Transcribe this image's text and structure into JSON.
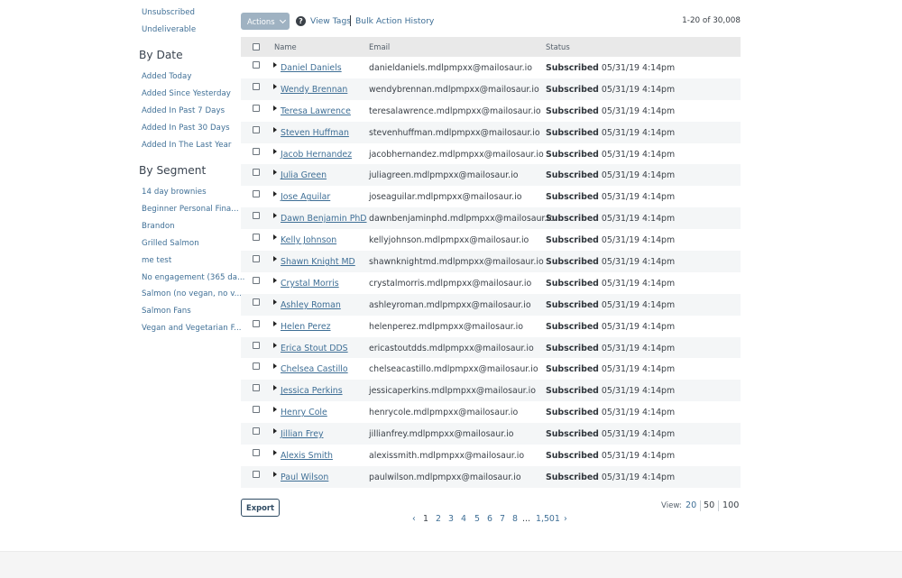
{
  "sidebar": {
    "top_links": [
      "Unsubscribed",
      "Undeliverable"
    ],
    "by_date_heading": "By Date",
    "by_date": [
      "Added Today",
      "Added Since Yesterday",
      "Added In Past 7 Days",
      "Added In Past 30 Days",
      "Added In The Last Year"
    ],
    "by_segment_heading": "By Segment",
    "by_segment": [
      "14 day brownies",
      "Beginner Personal Fina...",
      "Brandon",
      "Grilled Salmon",
      "me test",
      "No engagement (365 da...",
      "Salmon (no vegan, no v...",
      "Salmon Fans",
      "Vegan and Vegetarian F..."
    ]
  },
  "toolbar": {
    "actions_label": "Actions",
    "help_icon": "question-circle-icon",
    "view_tags": "View Tags",
    "bulk_history": "Bulk Action History",
    "range": "1-20 of 30,008"
  },
  "table": {
    "headers": {
      "name": "Name",
      "email": "Email",
      "status": "Status"
    },
    "rows": [
      {
        "name": "Daniel Daniels",
        "email": "danieldaniels.mdlpmpxx@mailosaur.io",
        "status": "Subscribed",
        "date": "05/31/19 4:14pm"
      },
      {
        "name": "Wendy Brennan",
        "email": "wendybrennan.mdlpmpxx@mailosaur.io",
        "status": "Subscribed",
        "date": "05/31/19 4:14pm"
      },
      {
        "name": "Teresa Lawrence",
        "email": "teresalawrence.mdlpmpxx@mailosaur.io",
        "status": "Subscribed",
        "date": "05/31/19 4:14pm"
      },
      {
        "name": "Steven Huffman",
        "email": "stevenhuffman.mdlpmpxx@mailosaur.io",
        "status": "Subscribed",
        "date": "05/31/19 4:14pm"
      },
      {
        "name": "Jacob Hernandez",
        "email": "jacobhernandez.mdlpmpxx@mailosaur.io",
        "status": "Subscribed",
        "date": "05/31/19 4:14pm"
      },
      {
        "name": "Julia Green",
        "email": "juliagreen.mdlpmpxx@mailosaur.io",
        "status": "Subscribed",
        "date": "05/31/19 4:14pm"
      },
      {
        "name": "Jose Aguilar",
        "email": "joseaguilar.mdlpmpxx@mailosaur.io",
        "status": "Subscribed",
        "date": "05/31/19 4:14pm"
      },
      {
        "name": "Dawn Benjamin PhD",
        "email": "dawnbenjaminphd.mdlpmpxx@mailosaur.io",
        "status": "Subscribed",
        "date": "05/31/19 4:14pm"
      },
      {
        "name": "Kelly Johnson",
        "email": "kellyjohnson.mdlpmpxx@mailosaur.io",
        "status": "Subscribed",
        "date": "05/31/19 4:14pm"
      },
      {
        "name": "Shawn Knight MD",
        "email": "shawnknightmd.mdlpmpxx@mailosaur.io",
        "status": "Subscribed",
        "date": "05/31/19 4:14pm"
      },
      {
        "name": "Crystal Morris",
        "email": "crystalmorris.mdlpmpxx@mailosaur.io",
        "status": "Subscribed",
        "date": "05/31/19 4:14pm"
      },
      {
        "name": "Ashley Roman",
        "email": "ashleyroman.mdlpmpxx@mailosaur.io",
        "status": "Subscribed",
        "date": "05/31/19 4:14pm"
      },
      {
        "name": "Helen Perez",
        "email": "helenperez.mdlpmpxx@mailosaur.io",
        "status": "Subscribed",
        "date": "05/31/19 4:14pm"
      },
      {
        "name": "Erica Stout DDS",
        "email": "ericastoutdds.mdlpmpxx@mailosaur.io",
        "status": "Subscribed",
        "date": "05/31/19 4:14pm"
      },
      {
        "name": "Chelsea Castillo",
        "email": "chelseacastillo.mdlpmpxx@mailosaur.io",
        "status": "Subscribed",
        "date": "05/31/19 4:14pm"
      },
      {
        "name": "Jessica Perkins",
        "email": "jessicaperkins.mdlpmpxx@mailosaur.io",
        "status": "Subscribed",
        "date": "05/31/19 4:14pm"
      },
      {
        "name": "Henry Cole",
        "email": "henrycole.mdlpmpxx@mailosaur.io",
        "status": "Subscribed",
        "date": "05/31/19 4:14pm"
      },
      {
        "name": "Jillian Frey",
        "email": "jillianfrey.mdlpmpxx@mailosaur.io",
        "status": "Subscribed",
        "date": "05/31/19 4:14pm"
      },
      {
        "name": "Alexis Smith",
        "email": "alexissmith.mdlpmpxx@mailosaur.io",
        "status": "Subscribed",
        "date": "05/31/19 4:14pm"
      },
      {
        "name": "Paul Wilson",
        "email": "paulwilson.mdlpmpxx@mailosaur.io",
        "status": "Subscribed",
        "date": "05/31/19 4:14pm"
      }
    ]
  },
  "footer": {
    "export_label": "Export",
    "pagination": {
      "prev": "‹",
      "pages": [
        "1",
        "2",
        "3",
        "4",
        "5",
        "6",
        "7",
        "8"
      ],
      "ellipsis": "...",
      "last": "1,501",
      "next": "›"
    },
    "view_label": "View:",
    "view_options": [
      "20",
      "50",
      "100"
    ],
    "view_selected": "20"
  },
  "colors": {
    "link": "#3f6f96",
    "actions_button": "#9fb2c2",
    "header_bg": "#e9e9e9",
    "alt_row_bg": "#f4f6f7"
  }
}
